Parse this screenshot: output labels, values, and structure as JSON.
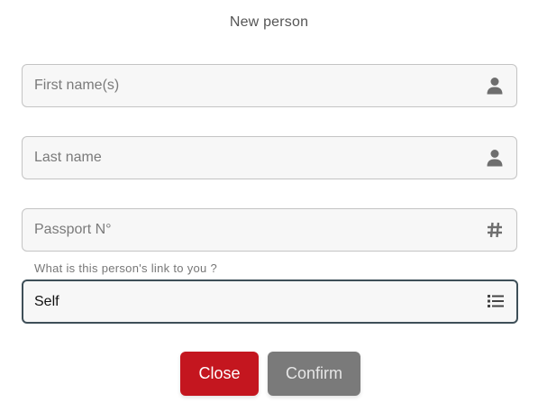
{
  "dialog": {
    "title": "New person"
  },
  "fields": {
    "first_name": {
      "placeholder": "First name(s)",
      "value": "",
      "icon": "person-icon"
    },
    "last_name": {
      "placeholder": "Last name",
      "value": "",
      "icon": "person-icon"
    },
    "passport": {
      "placeholder": "Passport N°",
      "value": "",
      "icon": "hash-icon"
    }
  },
  "link": {
    "label": "What is this person's link to you ?",
    "selected": "Self",
    "icon": "list-icon"
  },
  "actions": {
    "close_label": "Close",
    "confirm_label": "Confirm"
  },
  "colors": {
    "close": "#c4161f",
    "confirm": "#7a7a7a",
    "focus_border": "#3e4f58",
    "icon": "#6e6e6e"
  }
}
